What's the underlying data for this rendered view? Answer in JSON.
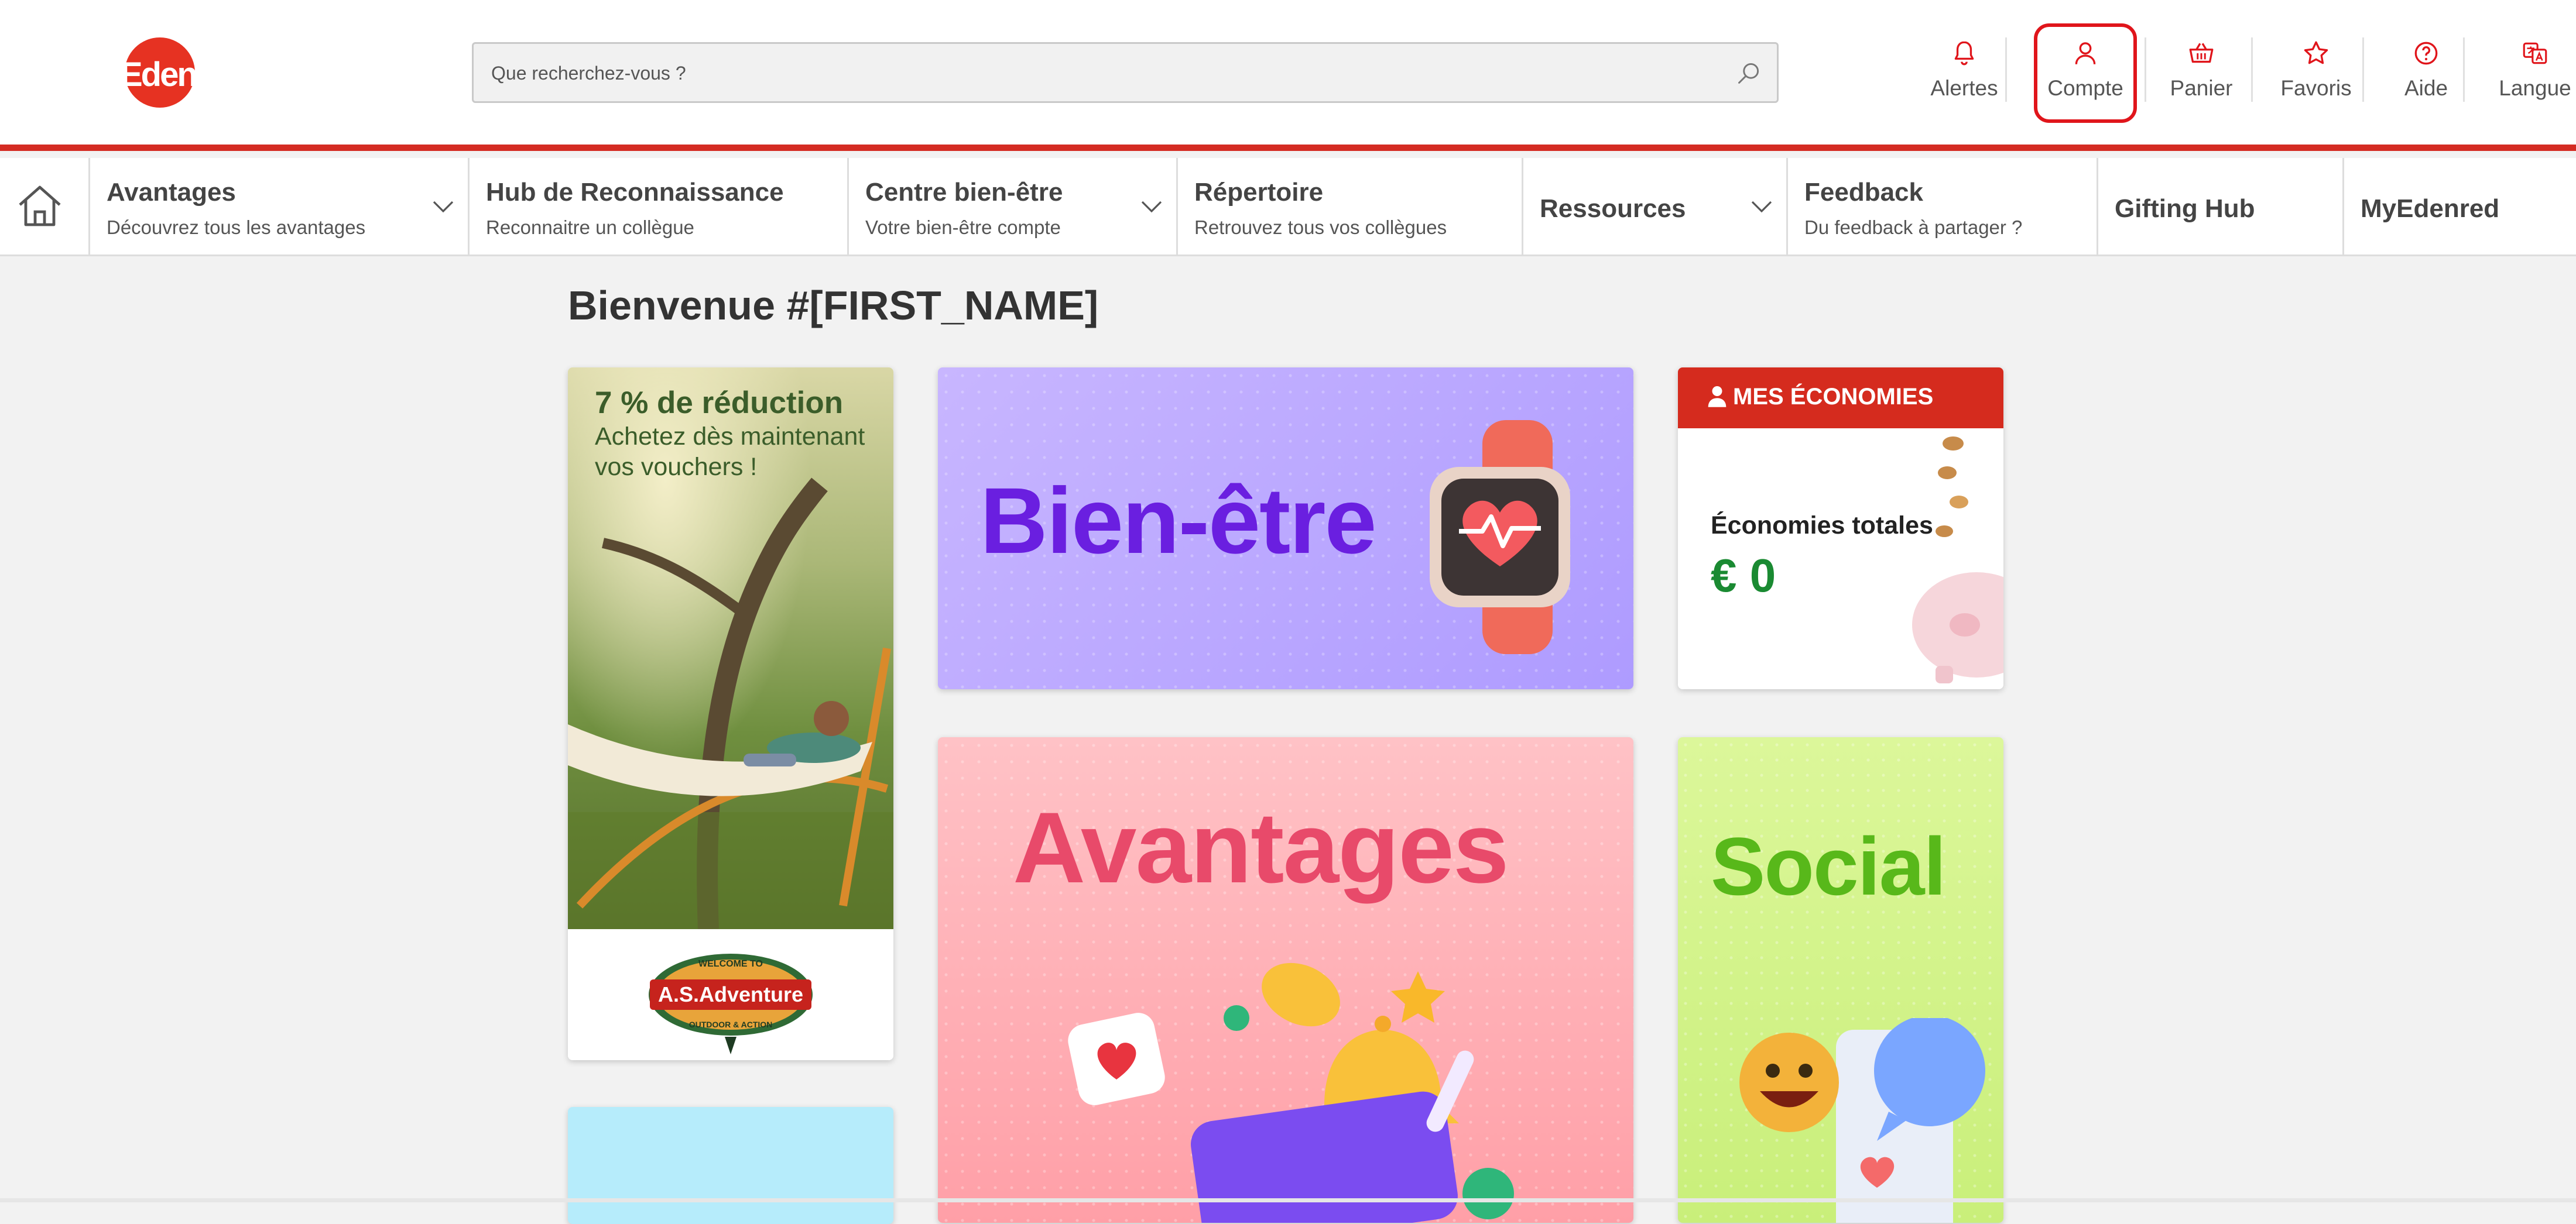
{
  "brand": {
    "logo_text": "Edenred",
    "accent": "#d42b22"
  },
  "search": {
    "placeholder": "Que recherchez-vous ?",
    "icon": "search-icon"
  },
  "top_actions": [
    {
      "label": "Alertes",
      "icon": "bell-icon"
    },
    {
      "label": "Compte",
      "icon": "user-icon",
      "highlighted": true
    },
    {
      "label": "Panier",
      "icon": "basket-icon"
    },
    {
      "label": "Favoris",
      "icon": "star-icon"
    },
    {
      "label": "Aide",
      "icon": "help-icon"
    },
    {
      "label": "Langue",
      "icon": "translate-icon"
    }
  ],
  "nav": {
    "home_icon": "home-icon",
    "items": [
      {
        "title": "Avantages",
        "subtitle": "Découvrez tous les avantages",
        "dropdown": true
      },
      {
        "title": "Hub de Reconnaissance",
        "subtitle": "Reconnaitre un collègue",
        "dropdown": false
      },
      {
        "title": "Centre bien-être",
        "subtitle": "Votre bien-être compte",
        "dropdown": true
      },
      {
        "title": "Répertoire",
        "subtitle": "Retrouvez tous vos collègues",
        "dropdown": false
      },
      {
        "title": "Ressources",
        "subtitle": "",
        "dropdown": true
      },
      {
        "title": "Feedback",
        "subtitle": "Du feedback à partager ?",
        "dropdown": false
      },
      {
        "title": "Gifting Hub",
        "subtitle": "",
        "dropdown": false
      },
      {
        "title": "MyEdenred",
        "subtitle": "",
        "dropdown": false
      }
    ]
  },
  "main": {
    "welcome": "Bienvenue #[FIRST_NAME]",
    "promo": {
      "headline": "7 % de réduction",
      "line1": "Achetez dès maintenant",
      "line2": "vos vouchers !",
      "brand_name": "A.S.Adventure",
      "brand_top": "WELCOME TO",
      "brand_bottom": "OUTDOOR & ACTION"
    },
    "tiles": {
      "wellness": "Bien-être",
      "advantages": "Avantages",
      "social": "Social"
    },
    "savings": {
      "header": "MES ÉCONOMIES",
      "label": "Économies totales",
      "amount": "€ 0"
    }
  }
}
